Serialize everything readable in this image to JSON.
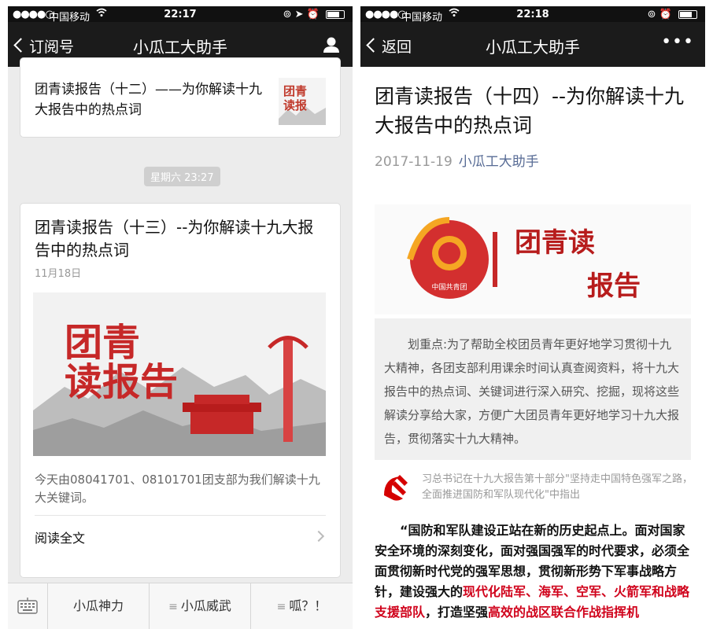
{
  "left": {
    "status": {
      "signal": "●●●●○",
      "carrier": "中国移动",
      "time": "22:17"
    },
    "nav": {
      "back": "订阅号",
      "title": "小瓜工大助手"
    },
    "prev_card": {
      "title": "团青读报告（十二）——为你解读十九大报告中的热点词",
      "thumb_text": "团青读报告"
    },
    "timestamp": "星期六 23:27",
    "main_card": {
      "title": "团青读报告（十三）--为你解读十九大报告中的热点词",
      "date": "11月18日",
      "cover_text_1": "团青",
      "cover_text_2": "读报告",
      "summary": "今天由08041701、08101701团支部为我们解读十九大关键词。",
      "read_more": "阅读全文"
    },
    "menu": {
      "item1": "小瓜神力",
      "item2": "小瓜威武",
      "item3": "呱？！"
    }
  },
  "right": {
    "status": {
      "signal": "●●●●○",
      "carrier": "中国移动",
      "time": "22:18"
    },
    "nav": {
      "back": "返回",
      "title": "小瓜工大助手",
      "more": "•••"
    },
    "article": {
      "title": "团青读报告（十四）--为你解读十九大报告中的热点词",
      "date": "2017-11-19",
      "author": "小瓜工大助手",
      "banner_text_1": "团青读",
      "banner_text_2": "报告",
      "badge_text": "中国共青团",
      "quote": "划重点:为了帮助全校团员青年更好地学习贯彻十九大精神，各团支部利用课余时间认真查阅资料，将十九大报告中的热点词、关键词进行深入研究、挖掘，现将这些解读分享给大家，方便广大团员青年更好地学习十九大报告，贯彻落实十九大精神。",
      "caption": "习总书记在十九大报告第十部分\"坚持走中国特色强军之路，全面推进国防和军队现代化\"中指出",
      "body_a": "“国防和军队建设正站在新的历史起点上。面对国家安全环境的深刻变化，面对强国强军的时代要求，必须全面贯彻新时代党的强军思想，贯彻新形势下军事战略方针，建设强大的",
      "body_red_1": "现代化陆军、海军、空军、火箭军和战略支援部队",
      "body_b": "，打造坚强",
      "body_red_2": "高效的战区联合作战指挥机"
    }
  },
  "colors": {
    "accent_red": "#d0021b",
    "link_blue": "#576b95",
    "nav_bg": "#1b1b1b"
  }
}
